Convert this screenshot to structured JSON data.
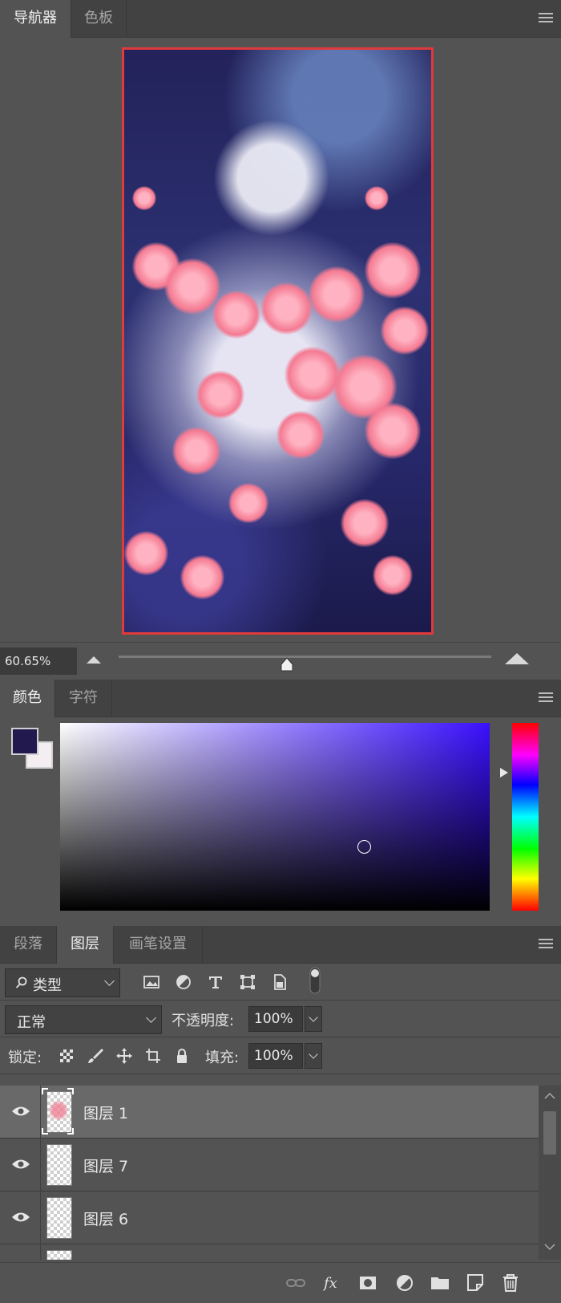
{
  "navigator": {
    "tabs": [
      {
        "label": "导航器"
      },
      {
        "label": "色板"
      }
    ],
    "zoom": "60.65%"
  },
  "color": {
    "tabs": [
      {
        "label": "颜色"
      },
      {
        "label": "字符"
      }
    ],
    "foreground": "#22194e",
    "background": "#f4eef3"
  },
  "layers_panel": {
    "tabs": [
      {
        "label": "段落"
      },
      {
        "label": "图层"
      },
      {
        "label": "画笔设置"
      }
    ],
    "filter_type": "类型",
    "blend_mode": "正常",
    "opacity_label": "不透明度:",
    "opacity": "100%",
    "lock_label": "锁定:",
    "fill_label": "填充:",
    "fill": "100%",
    "layers": [
      {
        "name": "图层 1",
        "selected": true
      },
      {
        "name": "图层 7",
        "selected": false
      },
      {
        "name": "图层 6",
        "selected": false
      }
    ]
  }
}
